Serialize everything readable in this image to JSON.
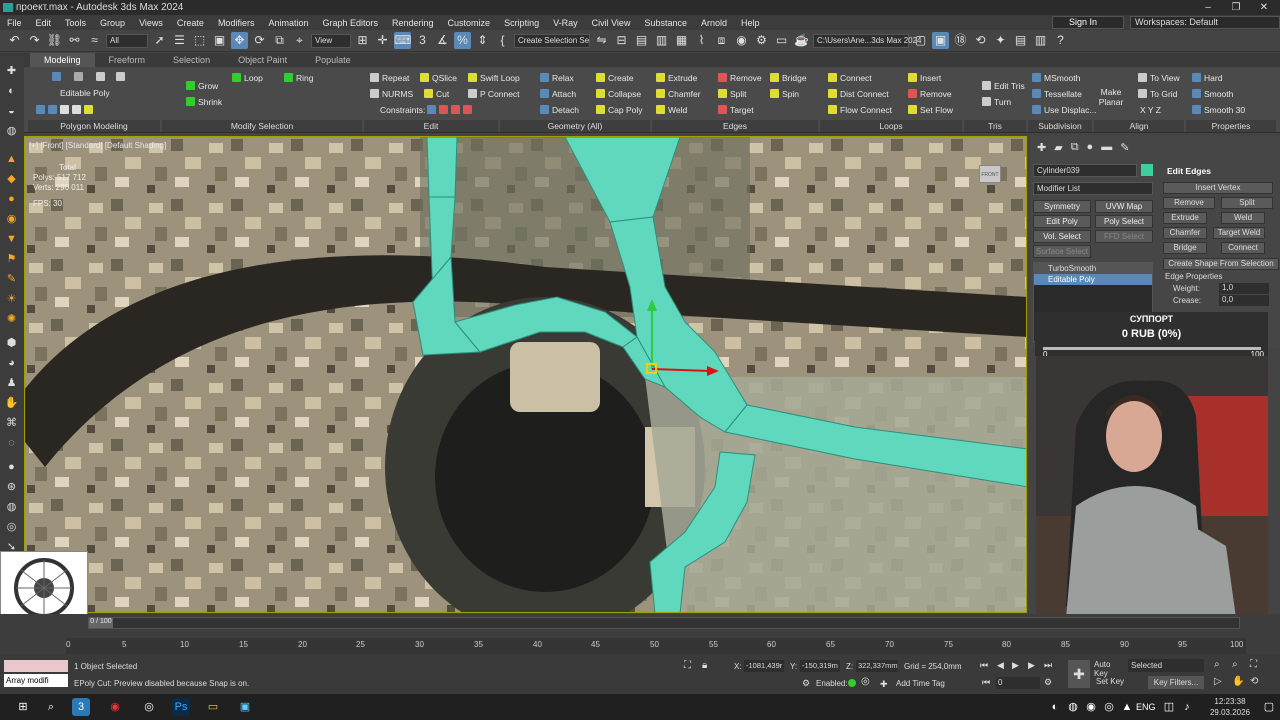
{
  "window": {
    "title": "проект.max - Autodesk 3ds Max 2024"
  },
  "menu": [
    "File",
    "Edit",
    "Tools",
    "Group",
    "Views",
    "Create",
    "Modifiers",
    "Animation",
    "Graph Editors",
    "Rendering",
    "Customize",
    "Scripting",
    "V-Ray",
    "Civil View",
    "Substance",
    "Arnold",
    "Help"
  ],
  "account": {
    "signin": "Sign In",
    "workspaces": "Workspaces: Default"
  },
  "toolbar": {
    "filter": "All",
    "coord": "View",
    "selset": "Create Selection Se",
    "path": "C:\\Users\\Ane...3ds Max 2024"
  },
  "ribbon_tabs": [
    "Modeling",
    "Freeform",
    "Selection",
    "Object Paint",
    "Populate"
  ],
  "ribbon": {
    "editable_poly": "Editable Poly",
    "grow": "Grow",
    "shrink": "Shrink",
    "loop": "Loop",
    "ring": "Ring",
    "repeat": "Repeat",
    "qslice": "QSlice",
    "swift_loop": "Swift Loop",
    "nurms": "NURMS",
    "cut": "Cut",
    "p_connect": "P Connect",
    "constraints": "Constraints:",
    "relax": "Relax",
    "create": "Create",
    "attach": "Attach",
    "collapse": "Collapse",
    "detach": "Detach",
    "cap_poly": "Cap Poly",
    "extrude": "Extrude",
    "remove": "Remove",
    "bridge": "Bridge",
    "chamfer": "Chamfer",
    "split": "Split",
    "spin": "Spin",
    "weld": "Weld",
    "target": "Target",
    "connect": "Connect",
    "dist_connect": "Dist Connect",
    "flow_connect": "Flow Connect",
    "insert": "Insert",
    "remove2": "Remove",
    "set_flow": "Set Flow",
    "edit_tris": "Edit Tris",
    "turn": "Turn",
    "msmooth": "MSmooth",
    "tessellate": "Tessellate",
    "use_displac": "Use Displac...",
    "make_planar": "Make Planar",
    "to_view": "To View",
    "to_grid": "To Grid",
    "xyz": "X  Y  Z",
    "hard": "Hard",
    "smooth": "Smooth",
    "smooth30": "Smooth 30",
    "footer": [
      "Polygon Modeling",
      "Modify Selection",
      "Edit",
      "Geometry (All)",
      "Edges",
      "Loops",
      "Tris",
      "Subdivision",
      "Align",
      "Properties"
    ]
  },
  "viewport": {
    "label": "[+] [Front] [Standard] [Default Shading]",
    "total": "Total",
    "polys": "Polys:  517 712",
    "verts": "Verts:  290 011",
    "fps": "FPS:    30",
    "viewcube": "FRONT"
  },
  "command_panel": {
    "object_name": "Cylinder039",
    "modifier_list": "Modifier List",
    "buttons": [
      "Symmetry",
      "UVW Map",
      "Edit Poly",
      "Poly Select",
      "Vol. Select",
      "FFD Select",
      "Surface Select"
    ],
    "stack": [
      "TurboSmooth",
      "Editable Poly"
    ],
    "rollout_title": "Edit Edges",
    "insert_vertex": "Insert Vertex",
    "remove": "Remove",
    "split": "Split",
    "extrude": "Extrude",
    "weld": "Weld",
    "chamfer": "Chamfer",
    "target_weld": "Target Weld",
    "bridge": "Bridge",
    "connect": "Connect",
    "create_shape": "Create Shape From Selection",
    "edge_props": "Edge Properties",
    "weight": "Weight:",
    "weight_val": "1,0",
    "crease": "Crease:",
    "crease_val": "0,0"
  },
  "donation": {
    "title": "СУППОРТ",
    "amount": "0 RUB (0%)",
    "min": "0",
    "max": "100",
    "progress": 0
  },
  "timeline": {
    "frame": "0 / 100",
    "ticks": [
      "0",
      "5",
      "10",
      "15",
      "20",
      "25",
      "30",
      "35",
      "40",
      "45",
      "50",
      "55",
      "60",
      "65",
      "70",
      "75",
      "80",
      "85",
      "90",
      "95",
      "100"
    ]
  },
  "status": {
    "script": "Array modifi",
    "selected": "1 Object Selected",
    "prompt": "EPoly Cut: Preview disabled because Snap is on.",
    "x": "-1081,439r",
    "y": "-150,319m",
    "z": "322,337mm",
    "grid": "Grid = 254,0mm",
    "enabled": "Enabled:",
    "add_time_tag": "Add Time Tag",
    "auto_key": "Auto Key",
    "set_key": "Set Key",
    "key_mode": "Selected",
    "key_filters": "Key Filters...",
    "frame_field": "0"
  },
  "taskbar": {
    "lang": "ENG",
    "time": "12:23:38",
    "date": "29.03.2026"
  },
  "colors": {
    "poly": "#5fd8bd",
    "accent": "#5a89b8"
  }
}
